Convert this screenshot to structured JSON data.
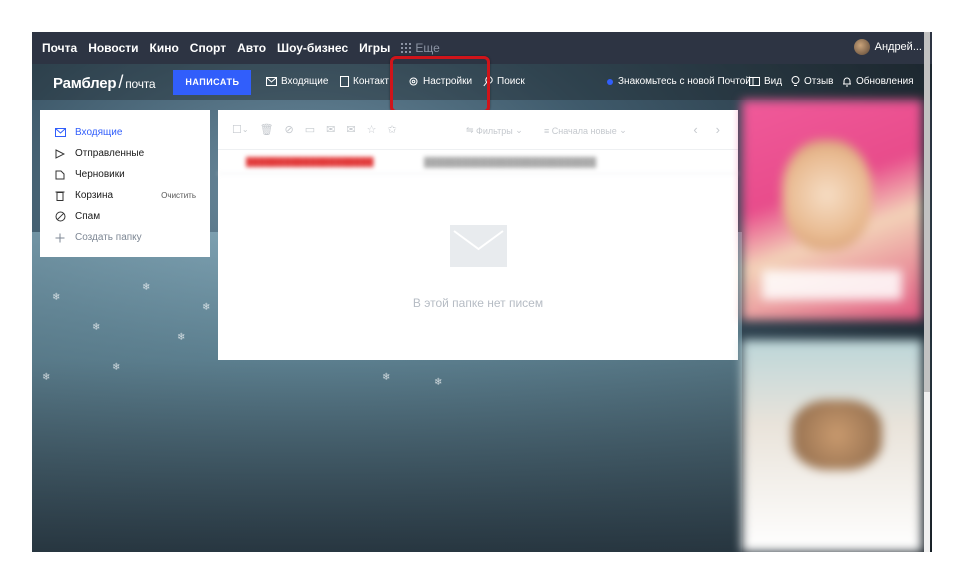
{
  "topnav": [
    "Почта",
    "Новости",
    "Кино",
    "Спорт",
    "Авто",
    "Шоу-бизнес",
    "Игры"
  ],
  "topnav_more": "Еще",
  "user_name": "Андрей...",
  "logo": {
    "brand": "Рамблер",
    "slash": "/",
    "product": "почта"
  },
  "compose_label": "НАПИСАТЬ",
  "mailnav": {
    "inbox": "Входящие",
    "contacts": "Контакт",
    "settings": "Настройки",
    "search": "Поиск",
    "discover": "Знакомьтесь с новой Почтой",
    "view": "Вид",
    "feedback": "Отзыв",
    "updates": "Обновления"
  },
  "folders": [
    {
      "label": "Входящие",
      "icon": "envelope-icon",
      "active": true
    },
    {
      "label": "Отправленные",
      "icon": "send-icon"
    },
    {
      "label": "Черновики",
      "icon": "draft-icon"
    },
    {
      "label": "Корзина",
      "icon": "trash-icon",
      "action": "Очистить"
    },
    {
      "label": "Спам",
      "icon": "spam-icon"
    },
    {
      "label": "Создать папку",
      "icon": "plus-icon"
    }
  ],
  "toolbar": {
    "filters": "Фильтры",
    "sort": "Сначала новые"
  },
  "empty_text": "В этой папке нет писем",
  "colors": {
    "accent": "#315efb",
    "topbar": "#2d3443",
    "highlight": "#d0141a"
  }
}
